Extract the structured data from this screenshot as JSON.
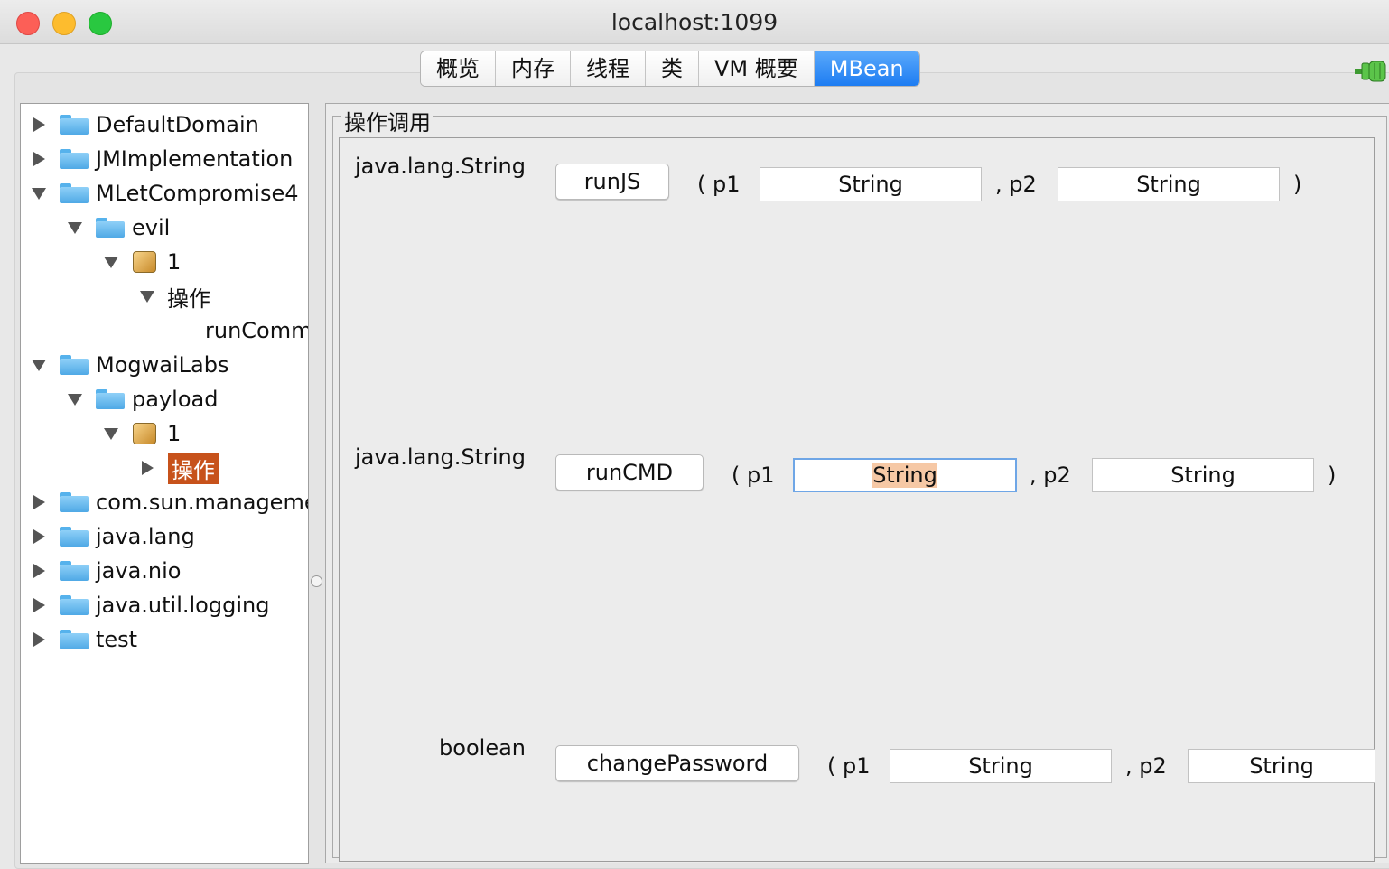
{
  "window": {
    "title": "localhost:1099"
  },
  "tabs": [
    {
      "label": "概览",
      "active": false
    },
    {
      "label": "内存",
      "active": false
    },
    {
      "label": "线程",
      "active": false
    },
    {
      "label": "类",
      "active": false
    },
    {
      "label": "VM 概要",
      "active": false
    },
    {
      "label": "MBean",
      "active": true
    }
  ],
  "tree": {
    "items": [
      {
        "label": "DefaultDomain",
        "icon": "folder-icon",
        "expanded": false
      },
      {
        "label": "JMImplementation",
        "icon": "folder-icon",
        "expanded": false
      },
      {
        "label": "MLetCompromise4",
        "icon": "folder-icon",
        "expanded": true
      },
      {
        "label": "evil",
        "icon": "folder-icon",
        "expanded": true
      },
      {
        "label": "1",
        "icon": "mbean-icon",
        "expanded": true
      },
      {
        "label": "操作",
        "icon": "none",
        "expanded": true
      },
      {
        "label": "runComm",
        "icon": "none"
      },
      {
        "label": "MogwaiLabs",
        "icon": "folder-icon",
        "expanded": true
      },
      {
        "label": "payload",
        "icon": "folder-icon",
        "expanded": true
      },
      {
        "label": "1",
        "icon": "mbean-icon",
        "expanded": true
      },
      {
        "label": "操作",
        "icon": "none",
        "expanded": false,
        "selected": true
      },
      {
        "label": "com.sun.manageme",
        "icon": "folder-icon",
        "expanded": false
      },
      {
        "label": "java.lang",
        "icon": "folder-icon",
        "expanded": false
      },
      {
        "label": "java.nio",
        "icon": "folder-icon",
        "expanded": false
      },
      {
        "label": "java.util.logging",
        "icon": "folder-icon",
        "expanded": false
      },
      {
        "label": "test",
        "icon": "folder-icon",
        "expanded": false
      }
    ]
  },
  "operations_panel": {
    "title": "操作调用",
    "operations": [
      {
        "return_type": "java.lang.String",
        "name": "runJS",
        "open": "( p1",
        "sep": ", p2",
        "close": ")",
        "p1_value": "String",
        "p2_value": "String"
      },
      {
        "return_type": "java.lang.String",
        "name": "runCMD",
        "open": "( p1",
        "sep": ", p2",
        "close": ")",
        "p1_value": "String",
        "p2_value": "String"
      },
      {
        "return_type": "boolean",
        "name": "changePassword",
        "open": "( p1",
        "sep": ", p2",
        "close": "",
        "p1_value": "String",
        "p2_value": "String"
      }
    ]
  },
  "colors": {
    "active_tab": "#1d7cf2",
    "selection": "#c7521b",
    "text_highlight": "#f6c8a5"
  }
}
